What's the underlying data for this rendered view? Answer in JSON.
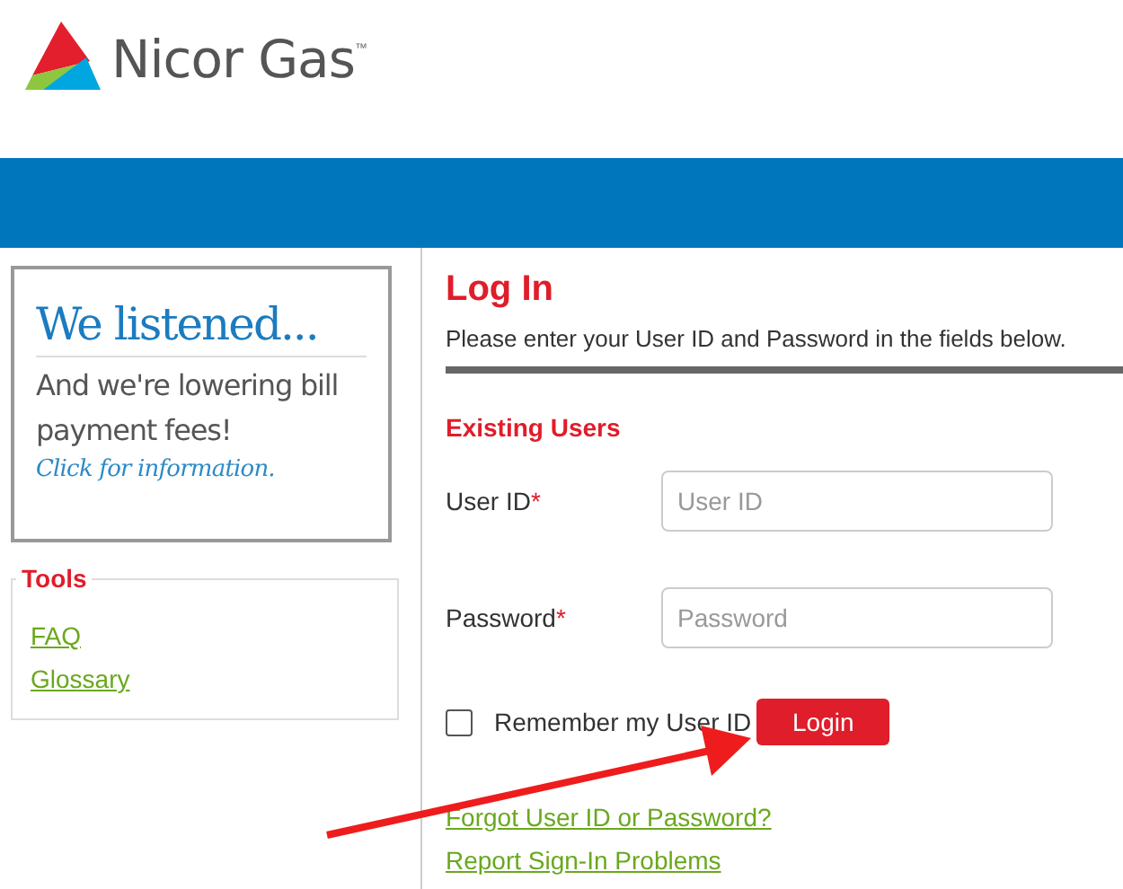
{
  "logo": {
    "text": "Nicor Gas",
    "trademark": "™"
  },
  "banner": {
    "headline": "We listened...",
    "body": "And we're lowering bill payment fees!",
    "link": "Click for information."
  },
  "tools": {
    "title": "Tools",
    "links": [
      "FAQ",
      "Glossary"
    ]
  },
  "login": {
    "title": "Log In",
    "instructions": "Please enter your User ID and Password in the fields below.",
    "section": "Existing Users",
    "fields": [
      {
        "label": "User ID",
        "required_mark": "*",
        "placeholder": "User ID"
      },
      {
        "label": "Password",
        "required_mark": "*",
        "placeholder": "Password"
      }
    ],
    "remember": {
      "label": "Remember my User ID",
      "checked": false
    },
    "button": "Login",
    "links": [
      "Forgot User ID or Password?",
      "Report Sign-In Problems"
    ]
  }
}
